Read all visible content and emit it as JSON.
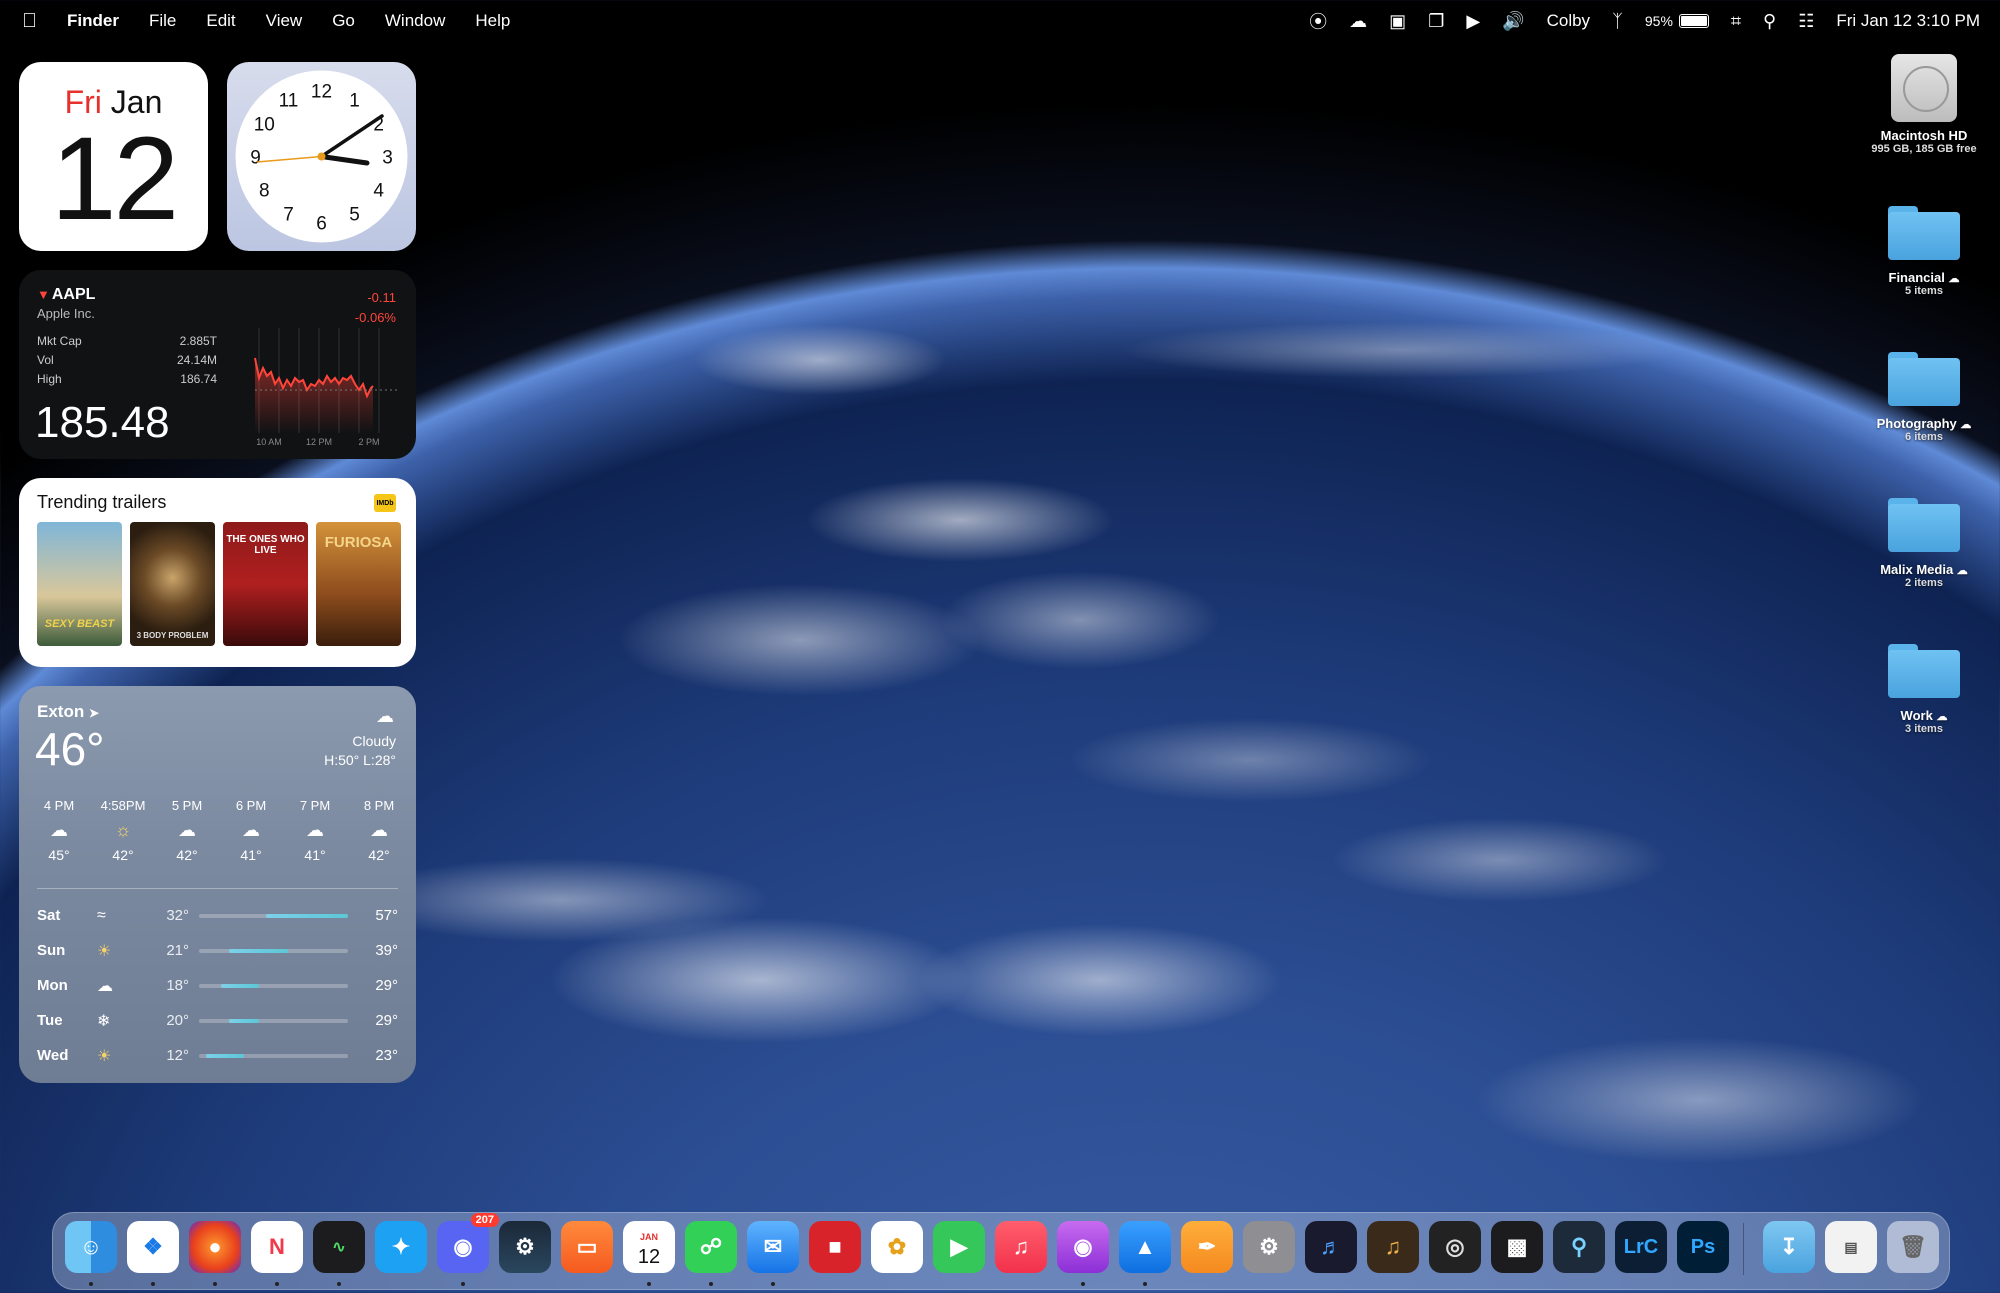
{
  "menubar": {
    "apple_icon": "apple-logo",
    "app_name": "Finder",
    "menus": [
      "File",
      "Edit",
      "View",
      "Go",
      "Window",
      "Help"
    ],
    "user": "Colby",
    "battery": "95%",
    "date_time": "Fri Jan 12  3:10 PM"
  },
  "calendar_widget": {
    "weekday": "Fri",
    "month": "Jan",
    "day": "12"
  },
  "clock_widget": {
    "numbers": [
      "12",
      "1",
      "2",
      "3",
      "4",
      "5",
      "6",
      "7",
      "8",
      "9",
      "10",
      "11"
    ]
  },
  "stock_widget": {
    "symbol": "AAPL",
    "company": "Apple Inc.",
    "change": "-0.11",
    "change_pct": "-0.06%",
    "stats": [
      {
        "label": "Mkt Cap",
        "value": "2.885T"
      },
      {
        "label": "Vol",
        "value": "24.14M"
      },
      {
        "label": "High",
        "value": "186.74"
      }
    ],
    "price": "185.48",
    "chart_ticks": [
      "10 AM",
      "12 PM",
      "2 PM"
    ],
    "colors": {
      "negative": "#ff453a"
    }
  },
  "trailers_widget": {
    "title": "Trending trailers",
    "logo": "IMDb",
    "posters": [
      {
        "title": "SEXY BEAST"
      },
      {
        "title": "3 BODY PROBLEM"
      },
      {
        "title": "THE ONES WHO LIVE"
      },
      {
        "title": "FURIOSA"
      }
    ]
  },
  "weather_widget": {
    "city": "Exton",
    "temp": "46°",
    "condition": "Cloudy",
    "hi_lo": "H:50° L:28°",
    "hourly": [
      {
        "time": "4 PM",
        "icon": "cloud-icon",
        "temp": "45°"
      },
      {
        "time": "4:58PM",
        "icon": "sunset-icon",
        "temp": "42°"
      },
      {
        "time": "5 PM",
        "icon": "cloud-icon",
        "temp": "42°"
      },
      {
        "time": "6 PM",
        "icon": "cloud-icon",
        "temp": "41°"
      },
      {
        "time": "7 PM",
        "icon": "cloud-icon",
        "temp": "41°"
      },
      {
        "time": "8 PM",
        "icon": "cloud-moon-icon",
        "temp": "42°"
      }
    ],
    "daily": [
      {
        "day": "Sat",
        "icon": "wind-icon",
        "lo": "32°",
        "hi": "57°",
        "range": [
          0.45,
          1.0
        ]
      },
      {
        "day": "Sun",
        "icon": "sun-icon",
        "lo": "21°",
        "hi": "39°",
        "range": [
          0.2,
          0.6
        ]
      },
      {
        "day": "Mon",
        "icon": "cloud-icon",
        "lo": "18°",
        "hi": "29°",
        "range": [
          0.15,
          0.4
        ]
      },
      {
        "day": "Tue",
        "icon": "snowflake-icon",
        "lo": "20°",
        "hi": "29°",
        "range": [
          0.2,
          0.4
        ]
      },
      {
        "day": "Wed",
        "icon": "sun-icon",
        "lo": "12°",
        "hi": "23°",
        "range": [
          0.05,
          0.3
        ]
      }
    ]
  },
  "desktop_icons": [
    {
      "name": "Macintosh HD",
      "sub": "995 GB, 185 GB free",
      "type": "disk"
    },
    {
      "name": "Financial",
      "sub": "5 items",
      "type": "folder"
    },
    {
      "name": "Photography",
      "sub": "6 items",
      "type": "folder"
    },
    {
      "name": "Malix Media",
      "sub": "2 items",
      "type": "folder"
    },
    {
      "name": "Work",
      "sub": "3 items",
      "type": "folder"
    }
  ],
  "dock": {
    "discord_badge": "207",
    "calendar_month": "JAN",
    "calendar_day": "12",
    "lightroom_label": "LrC",
    "photoshop_label": "Ps"
  }
}
